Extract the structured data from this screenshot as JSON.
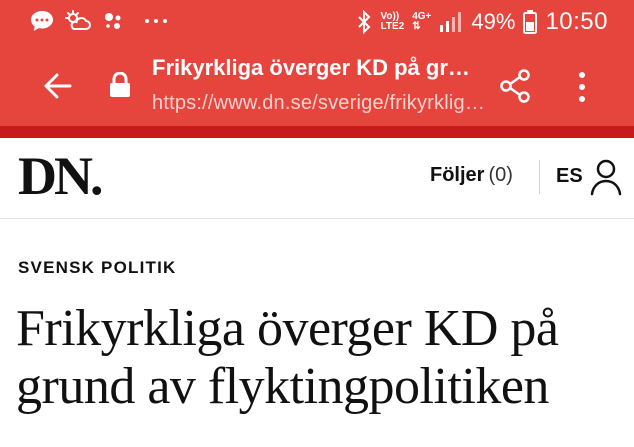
{
  "status_bar": {
    "network_top": "Vo))",
    "network_bottom": "LTE2",
    "data_top": "4G+",
    "battery": "49%",
    "time": "10:50",
    "icons": [
      "chat-icon",
      "weather-icon",
      "assistant-icon",
      "more-notifications-icon",
      "bluetooth-icon",
      "signal-icon",
      "battery-icon"
    ]
  },
  "browser": {
    "title": "Frikyrkliga överger KD på grund av flyktingpolitiken",
    "url": "https://www.dn.se/sverige/frikyrkliga-overger-kd",
    "toolbar_color": "#e5453d",
    "accent_color": "#c71b1b"
  },
  "header": {
    "logo": "DN.",
    "follow_label": "Följer",
    "follow_count": "(0)",
    "user_initials": "ES"
  },
  "article": {
    "category": "SVENSK POLITIK",
    "headline": "Frikyrkliga överger KD på grund av flyktingpolitiken"
  }
}
